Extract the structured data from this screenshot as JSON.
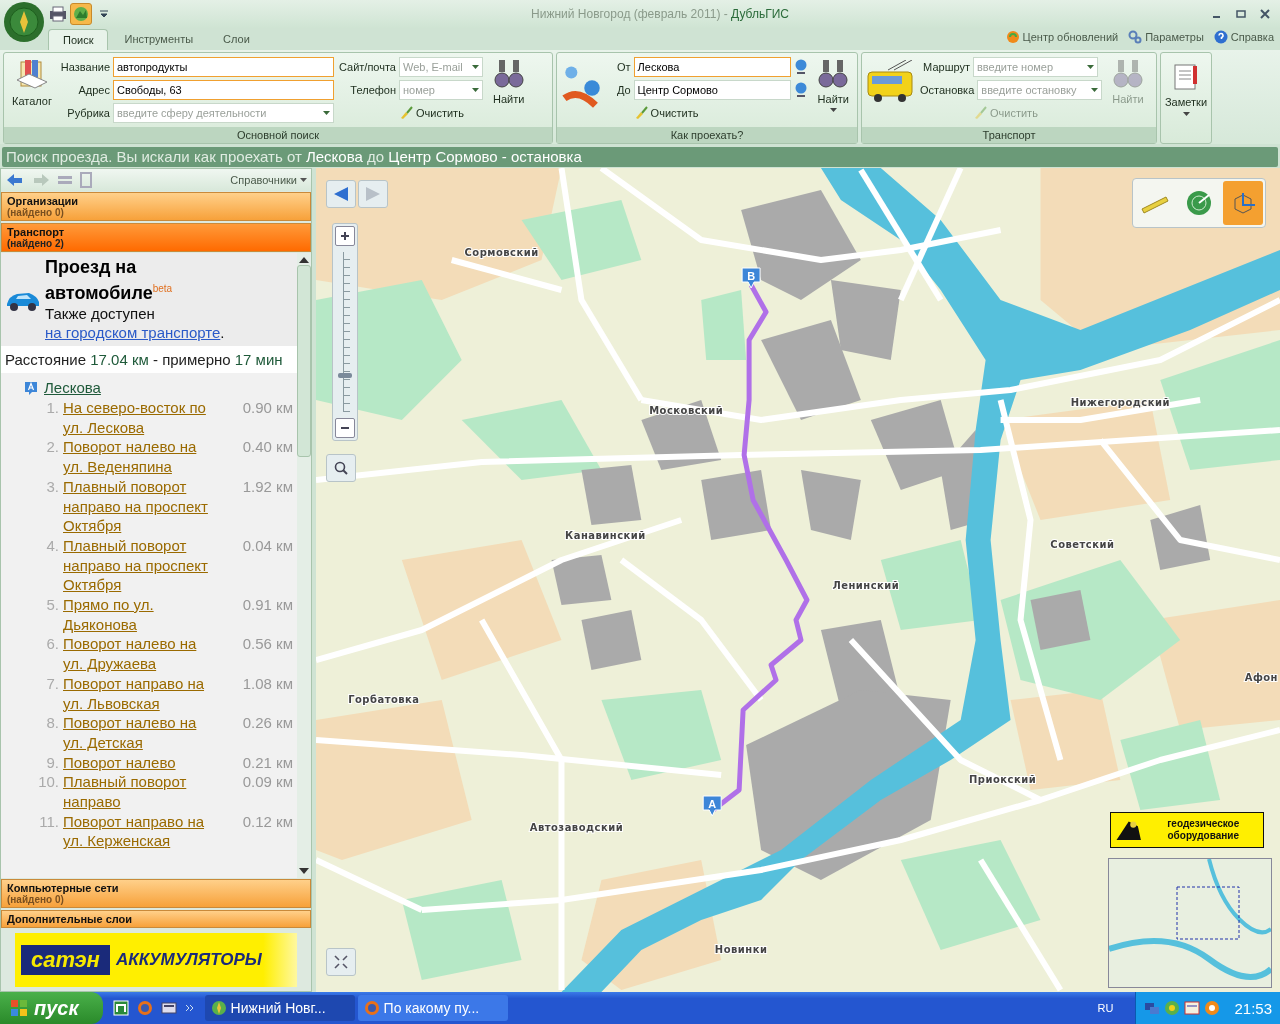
{
  "window": {
    "title": "Нижний Новгород (февраль 2011) -",
    "app_name": "ДубльГИС"
  },
  "tabs": [
    {
      "label": "Поиск",
      "selected": true
    },
    {
      "label": "Инструменты",
      "selected": false
    },
    {
      "label": "Слои",
      "selected": false
    }
  ],
  "header_links": [
    {
      "kind": "update",
      "label": "Центр обновлений"
    },
    {
      "kind": "settings",
      "label": "Параметры"
    },
    {
      "kind": "help",
      "label": "Справка"
    }
  ],
  "ribbon": {
    "main_search": {
      "caption": "Основной поиск",
      "catalog_button": "Каталог",
      "fields": [
        {
          "label": "Название",
          "kind": "text",
          "value": "автопродукты"
        },
        {
          "label": "Адрес",
          "kind": "text",
          "value": "Свободы, 63"
        },
        {
          "label": "Рубрика",
          "kind": "dropdown",
          "placeholder": "введите сферу деятельности"
        }
      ],
      "side_fields": [
        {
          "label": "Сайт/почта",
          "kind": "dropdown",
          "placeholder": "Web, E-mail"
        },
        {
          "label": "Телефон",
          "kind": "dropdown",
          "placeholder": "номер"
        }
      ],
      "clear_button": {
        "label": "Очистить",
        "disabled": false
      },
      "find_button": {
        "label": "Найти",
        "disabled": false,
        "menu": false
      }
    },
    "route": {
      "caption": "Как проехать?",
      "fields": [
        {
          "label": "От",
          "kind": "text",
          "value": "Лескова"
        },
        {
          "label": "До",
          "kind": "text",
          "value": "Центр Сормово"
        }
      ],
      "clear_button": {
        "label": "Очистить",
        "disabled": false
      },
      "find_button": {
        "label": "Найти",
        "disabled": false,
        "menu": true
      }
    },
    "transport": {
      "caption": "Транспорт",
      "fields": [
        {
          "label": "Маршрут",
          "kind": "dropdown",
          "placeholder": "введите номер"
        },
        {
          "label": "Остановка",
          "kind": "dropdown",
          "placeholder": "введите остановку"
        }
      ],
      "clear_button": {
        "label": "Очистить",
        "disabled": true
      },
      "find_button": {
        "label": "Найти",
        "disabled": true,
        "menu": false
      }
    },
    "notes_button": "Заметки"
  },
  "search_status": "Поиск проезда. Вы искали как проехать от **Лескова** до **Центр Сормово - остановка**",
  "sidebar": {
    "directory_menu": "Справочники",
    "sections_top": [
      {
        "title": "Организации",
        "count": "(найдено 0)",
        "disabled": true,
        "selected": false
      },
      {
        "title": "Транспорт",
        "count": "(найдено 2)",
        "disabled": false,
        "selected": true
      }
    ],
    "result": {
      "title": "Проезд на автомобиле",
      "badge": "beta",
      "also_text": "Также доступен",
      "also_link": "на городском транспорте",
      "also_end": ".",
      "distance": "Расстояние **17.04 км** - примерно **17 мин**",
      "start": "Лескова",
      "steps": [
        {
          "num": "1.",
          "text": "На северо-восток по ул. Лескова",
          "distance": "0.90 км"
        },
        {
          "num": "2.",
          "text": "Поворот налево на ул. Веденяпина",
          "distance": "0.40 км"
        },
        {
          "num": "3.",
          "text": "Плавный поворот направо на проспект Октября",
          "distance": "1.92 км"
        },
        {
          "num": "4.",
          "text": "Плавный поворот направо на проспект Октября",
          "distance": "0.04 км"
        },
        {
          "num": "5.",
          "text": "Прямо по ул. Дьяконова",
          "distance": "0.91 км"
        },
        {
          "num": "6.",
          "text": "Поворот налево на ул. Дружаева",
          "distance": "0.56 км"
        },
        {
          "num": "7.",
          "text": "Поворот направо на ул. Львовская",
          "distance": "1.08 км"
        },
        {
          "num": "8.",
          "text": "Поворот налево на ул. Детская",
          "distance": "0.26 км"
        },
        {
          "num": "9.",
          "text": "Поворот налево",
          "distance": "0.21 км"
        },
        {
          "num": "10.",
          "text": "Плавный поворот направо",
          "distance": "0.09 км"
        },
        {
          "num": "11.",
          "text": "Поворот направо на ул. Керженская",
          "distance": "0.12 км"
        }
      ]
    },
    "sections_bottom": [
      {
        "title": "Компьютерные сети",
        "count": "(найдено 0)",
        "disabled": true,
        "selected": false
      },
      {
        "title": "Дополнительные слои",
        "selected": false
      }
    ],
    "ad": {
      "logo": "сатэн",
      "text": "АККУМУЛЯТОРЫ"
    }
  },
  "map": {
    "back_disabled": false,
    "forward_disabled": true,
    "zoom": {
      "level": 0.22
    },
    "tools": [
      {
        "kind": "ruler",
        "selected": false
      },
      {
        "kind": "radar",
        "selected": false
      },
      {
        "kind": "cube",
        "selected": true
      }
    ],
    "labels": [
      "Сормовский",
      "Московский",
      "Нижегородский",
      "Канавинский",
      "Советский",
      "Ленинский",
      "Горбатовка",
      "Приокский",
      "Автозаводский",
      "Новинки",
      "Афон"
    ],
    "markers": [
      "B",
      "A"
    ],
    "ad": "геодезическое оборудование"
  },
  "taskbar": {
    "start": "пуск",
    "tasks": [
      {
        "kind": "app",
        "label": "Нижний Новг...",
        "selected": true
      },
      {
        "kind": "browser",
        "label": "По какому пу...",
        "selected": false
      }
    ],
    "language": "RU",
    "clock": "21:53"
  }
}
